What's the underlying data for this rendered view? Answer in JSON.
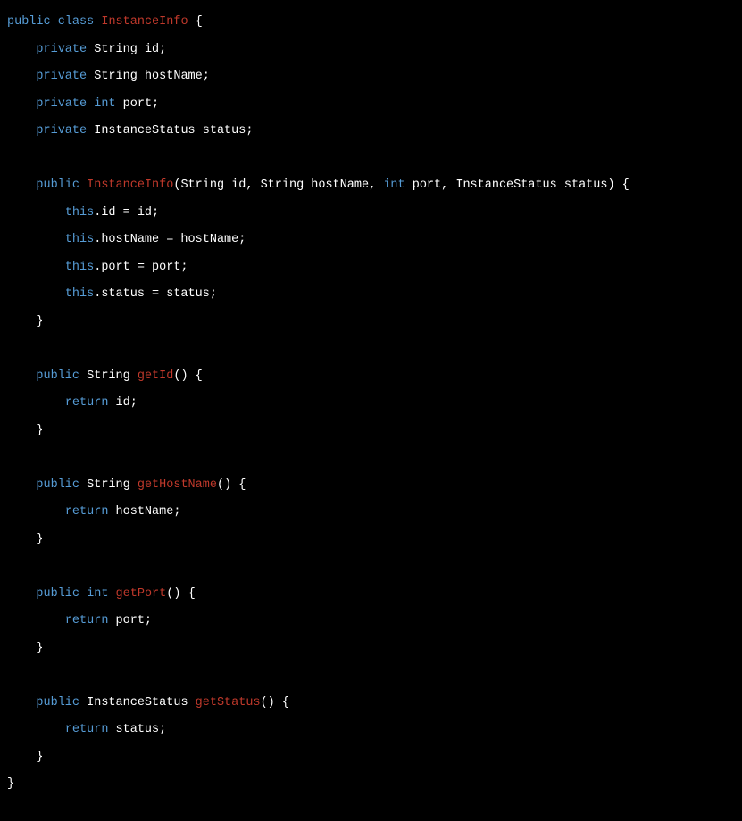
{
  "code": {
    "tokens": [
      {
        "t": "public",
        "c": "kw"
      },
      {
        "t": " ",
        "c": "punct"
      },
      {
        "t": "class",
        "c": "kw"
      },
      {
        "t": " ",
        "c": "punct"
      },
      {
        "t": "InstanceInfo",
        "c": "cls"
      },
      {
        "t": " {",
        "c": "punct"
      },
      {
        "t": "\n",
        "c": "punct"
      },
      {
        "t": "    ",
        "c": "punct"
      },
      {
        "t": "private",
        "c": "kw"
      },
      {
        "t": " ",
        "c": "punct"
      },
      {
        "t": "String",
        "c": "type"
      },
      {
        "t": " id;",
        "c": "type"
      },
      {
        "t": "\n",
        "c": "punct"
      },
      {
        "t": "    ",
        "c": "punct"
      },
      {
        "t": "private",
        "c": "kw"
      },
      {
        "t": " ",
        "c": "punct"
      },
      {
        "t": "String",
        "c": "type"
      },
      {
        "t": " hostName;",
        "c": "type"
      },
      {
        "t": "\n",
        "c": "punct"
      },
      {
        "t": "    ",
        "c": "punct"
      },
      {
        "t": "private",
        "c": "kw"
      },
      {
        "t": " ",
        "c": "punct"
      },
      {
        "t": "int",
        "c": "kw"
      },
      {
        "t": " port;",
        "c": "type"
      },
      {
        "t": "\n",
        "c": "punct"
      },
      {
        "t": "    ",
        "c": "punct"
      },
      {
        "t": "private",
        "c": "kw"
      },
      {
        "t": " ",
        "c": "punct"
      },
      {
        "t": "InstanceStatus",
        "c": "type"
      },
      {
        "t": " status;",
        "c": "type"
      },
      {
        "t": "\n",
        "c": "punct"
      },
      {
        "t": "\n",
        "c": "punct"
      },
      {
        "t": "    ",
        "c": "punct"
      },
      {
        "t": "public",
        "c": "kw"
      },
      {
        "t": " ",
        "c": "punct"
      },
      {
        "t": "InstanceInfo",
        "c": "cls"
      },
      {
        "t": "(",
        "c": "punct"
      },
      {
        "t": "String",
        "c": "type"
      },
      {
        "t": " id, ",
        "c": "type"
      },
      {
        "t": "String",
        "c": "type"
      },
      {
        "t": " hostName, ",
        "c": "type"
      },
      {
        "t": "int",
        "c": "kw"
      },
      {
        "t": " port, ",
        "c": "type"
      },
      {
        "t": "InstanceStatus",
        "c": "type"
      },
      {
        "t": " status) {",
        "c": "type"
      },
      {
        "t": "\n",
        "c": "punct"
      },
      {
        "t": "        ",
        "c": "punct"
      },
      {
        "t": "this",
        "c": "kw"
      },
      {
        "t": ".id = id;",
        "c": "type"
      },
      {
        "t": "\n",
        "c": "punct"
      },
      {
        "t": "        ",
        "c": "punct"
      },
      {
        "t": "this",
        "c": "kw"
      },
      {
        "t": ".hostName = hostName;",
        "c": "type"
      },
      {
        "t": "\n",
        "c": "punct"
      },
      {
        "t": "        ",
        "c": "punct"
      },
      {
        "t": "this",
        "c": "kw"
      },
      {
        "t": ".port = port;",
        "c": "type"
      },
      {
        "t": "\n",
        "c": "punct"
      },
      {
        "t": "        ",
        "c": "punct"
      },
      {
        "t": "this",
        "c": "kw"
      },
      {
        "t": ".status = status;",
        "c": "type"
      },
      {
        "t": "\n",
        "c": "punct"
      },
      {
        "t": "    }",
        "c": "type"
      },
      {
        "t": "\n",
        "c": "punct"
      },
      {
        "t": "\n",
        "c": "punct"
      },
      {
        "t": "    ",
        "c": "punct"
      },
      {
        "t": "public",
        "c": "kw"
      },
      {
        "t": " ",
        "c": "punct"
      },
      {
        "t": "String",
        "c": "type"
      },
      {
        "t": " ",
        "c": "punct"
      },
      {
        "t": "getId",
        "c": "cls"
      },
      {
        "t": "() {",
        "c": "type"
      },
      {
        "t": "\n",
        "c": "punct"
      },
      {
        "t": "        ",
        "c": "punct"
      },
      {
        "t": "return",
        "c": "kw"
      },
      {
        "t": " id;",
        "c": "type"
      },
      {
        "t": "\n",
        "c": "punct"
      },
      {
        "t": "    }",
        "c": "type"
      },
      {
        "t": "\n",
        "c": "punct"
      },
      {
        "t": "\n",
        "c": "punct"
      },
      {
        "t": "    ",
        "c": "punct"
      },
      {
        "t": "public",
        "c": "kw"
      },
      {
        "t": " ",
        "c": "punct"
      },
      {
        "t": "String",
        "c": "type"
      },
      {
        "t": " ",
        "c": "punct"
      },
      {
        "t": "getHostName",
        "c": "cls"
      },
      {
        "t": "() {",
        "c": "type"
      },
      {
        "t": "\n",
        "c": "punct"
      },
      {
        "t": "        ",
        "c": "punct"
      },
      {
        "t": "return",
        "c": "kw"
      },
      {
        "t": " hostName;",
        "c": "type"
      },
      {
        "t": "\n",
        "c": "punct"
      },
      {
        "t": "    }",
        "c": "type"
      },
      {
        "t": "\n",
        "c": "punct"
      },
      {
        "t": "\n",
        "c": "punct"
      },
      {
        "t": "    ",
        "c": "punct"
      },
      {
        "t": "public",
        "c": "kw"
      },
      {
        "t": " ",
        "c": "punct"
      },
      {
        "t": "int",
        "c": "kw"
      },
      {
        "t": " ",
        "c": "punct"
      },
      {
        "t": "getPort",
        "c": "cls"
      },
      {
        "t": "() {",
        "c": "type"
      },
      {
        "t": "\n",
        "c": "punct"
      },
      {
        "t": "        ",
        "c": "punct"
      },
      {
        "t": "return",
        "c": "kw"
      },
      {
        "t": " port;",
        "c": "type"
      },
      {
        "t": "\n",
        "c": "punct"
      },
      {
        "t": "    }",
        "c": "type"
      },
      {
        "t": "\n",
        "c": "punct"
      },
      {
        "t": "\n",
        "c": "punct"
      },
      {
        "t": "    ",
        "c": "punct"
      },
      {
        "t": "public",
        "c": "kw"
      },
      {
        "t": " ",
        "c": "punct"
      },
      {
        "t": "InstanceStatus",
        "c": "type"
      },
      {
        "t": " ",
        "c": "punct"
      },
      {
        "t": "getStatus",
        "c": "cls"
      },
      {
        "t": "() {",
        "c": "type"
      },
      {
        "t": "\n",
        "c": "punct"
      },
      {
        "t": "        ",
        "c": "punct"
      },
      {
        "t": "return",
        "c": "kw"
      },
      {
        "t": " status;",
        "c": "type"
      },
      {
        "t": "\n",
        "c": "punct"
      },
      {
        "t": "    }",
        "c": "type"
      },
      {
        "t": "\n",
        "c": "punct"
      },
      {
        "t": "}",
        "c": "type"
      }
    ]
  }
}
